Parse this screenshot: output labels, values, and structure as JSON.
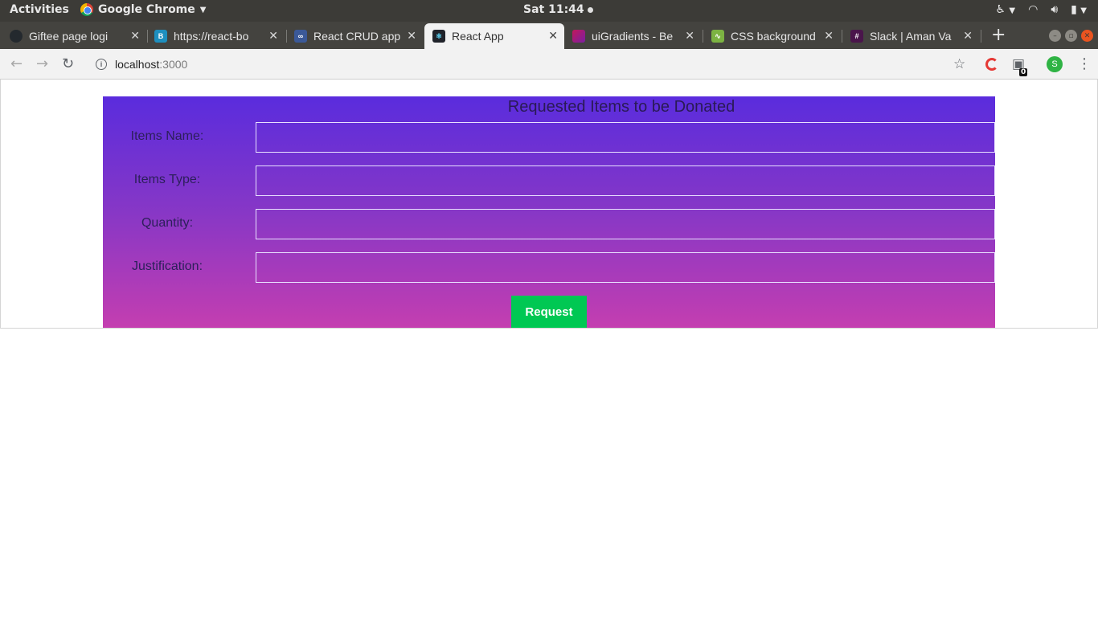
{
  "system_bar": {
    "activities": "Activities",
    "app_name": "Google Chrome",
    "clock": "Sat 11:44"
  },
  "tabs": [
    {
      "title": "Giftee page logi",
      "icon": "github-icon",
      "color": "#24292e",
      "active": false
    },
    {
      "title": "https://react-bo",
      "icon": "react-bootstrap-icon",
      "color": "#1e8fbf",
      "active": false
    },
    {
      "title": "React CRUD app",
      "icon": "codesandbox-icon",
      "color": "#3b5998",
      "active": false
    },
    {
      "title": "React App",
      "icon": "react-icon",
      "color": "#20232a",
      "active": true
    },
    {
      "title": "uiGradients - Be",
      "icon": "uigradients-icon",
      "color": "#c2185b",
      "active": false
    },
    {
      "title": "CSS background",
      "icon": "css-icon",
      "color": "#7cb342",
      "active": false
    },
    {
      "title": "Slack | Aman Va",
      "icon": "slack-icon",
      "color": "#4a154b",
      "active": false
    }
  ],
  "address_bar": {
    "host": "localhost",
    "port": ":3000",
    "extension_badge": "0",
    "profile_initial": "S"
  },
  "form": {
    "title": "Requested Items to be Donated",
    "fields": [
      {
        "label": "Items Name:",
        "value": ""
      },
      {
        "label": "Items Type:",
        "value": ""
      },
      {
        "label": "Quantity:",
        "value": ""
      },
      {
        "label": "Justification:",
        "value": ""
      }
    ],
    "submit_label": "Request"
  },
  "colors": {
    "gradient_top": "#5a2cdd",
    "gradient_bottom": "#c43eb0",
    "button": "#00c853"
  }
}
